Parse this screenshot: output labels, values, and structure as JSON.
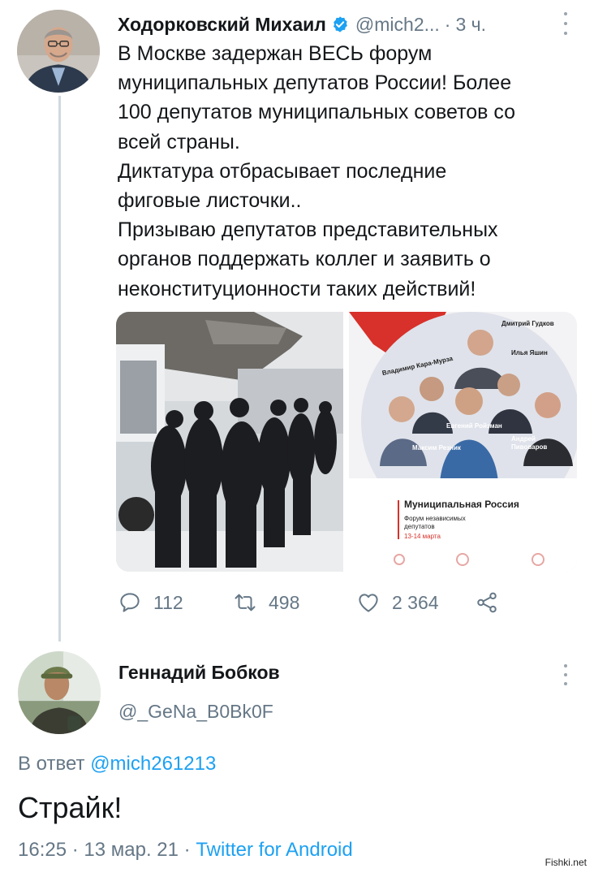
{
  "tweet1": {
    "author_name": "Ходорковский Михаил",
    "handle": "@mich2...",
    "dot": "·",
    "time": "3 ч.",
    "text_lines": [
      "В Москве задержан ВЕСЬ форум",
      "муниципальных депутатов России! Более",
      "100 депутатов муниципальных советов со",
      "всей страны.",
      "Диктатура отбрасывает последние",
      "фиговые листочки..",
      "Призываю депутатов представительных",
      "органов поддержать коллег и заявить о",
      "неконституционности таких действий!"
    ],
    "poster": {
      "names": [
        "Дмитрий Гудков",
        "Владимир Кара-Мурза",
        "Илья Яшин",
        "Евгений Ройзман",
        "Максим Резник",
        "Андрей",
        "Пивоваров"
      ],
      "title": "Муниципальная Россия",
      "subtitle_lines": [
        "Форум независимых",
        "депутатов"
      ],
      "dates": "13-14 марта"
    },
    "actions": {
      "replies": "112",
      "retweets": "498",
      "likes": "2 364"
    }
  },
  "tweet2": {
    "author_name": "Геннадий Бобков",
    "handle": "@_GeNa_B0Bk0F",
    "reply_prefix": "В ответ",
    "reply_mention": "@mich261213",
    "text": "Страйк!",
    "timestamp": "16:25 · 13 мар. 21 · ",
    "source": "Twitter for Android"
  },
  "watermark": "Fishki.net",
  "colors": {
    "accent": "#1da1f2",
    "secondary_text": "#657786",
    "thread_line": "#cfd9de",
    "verified": "#1da1f2"
  },
  "icons": [
    "verified-badge-icon",
    "more-icon",
    "reply-icon",
    "retweet-icon",
    "like-icon",
    "share-icon"
  ]
}
